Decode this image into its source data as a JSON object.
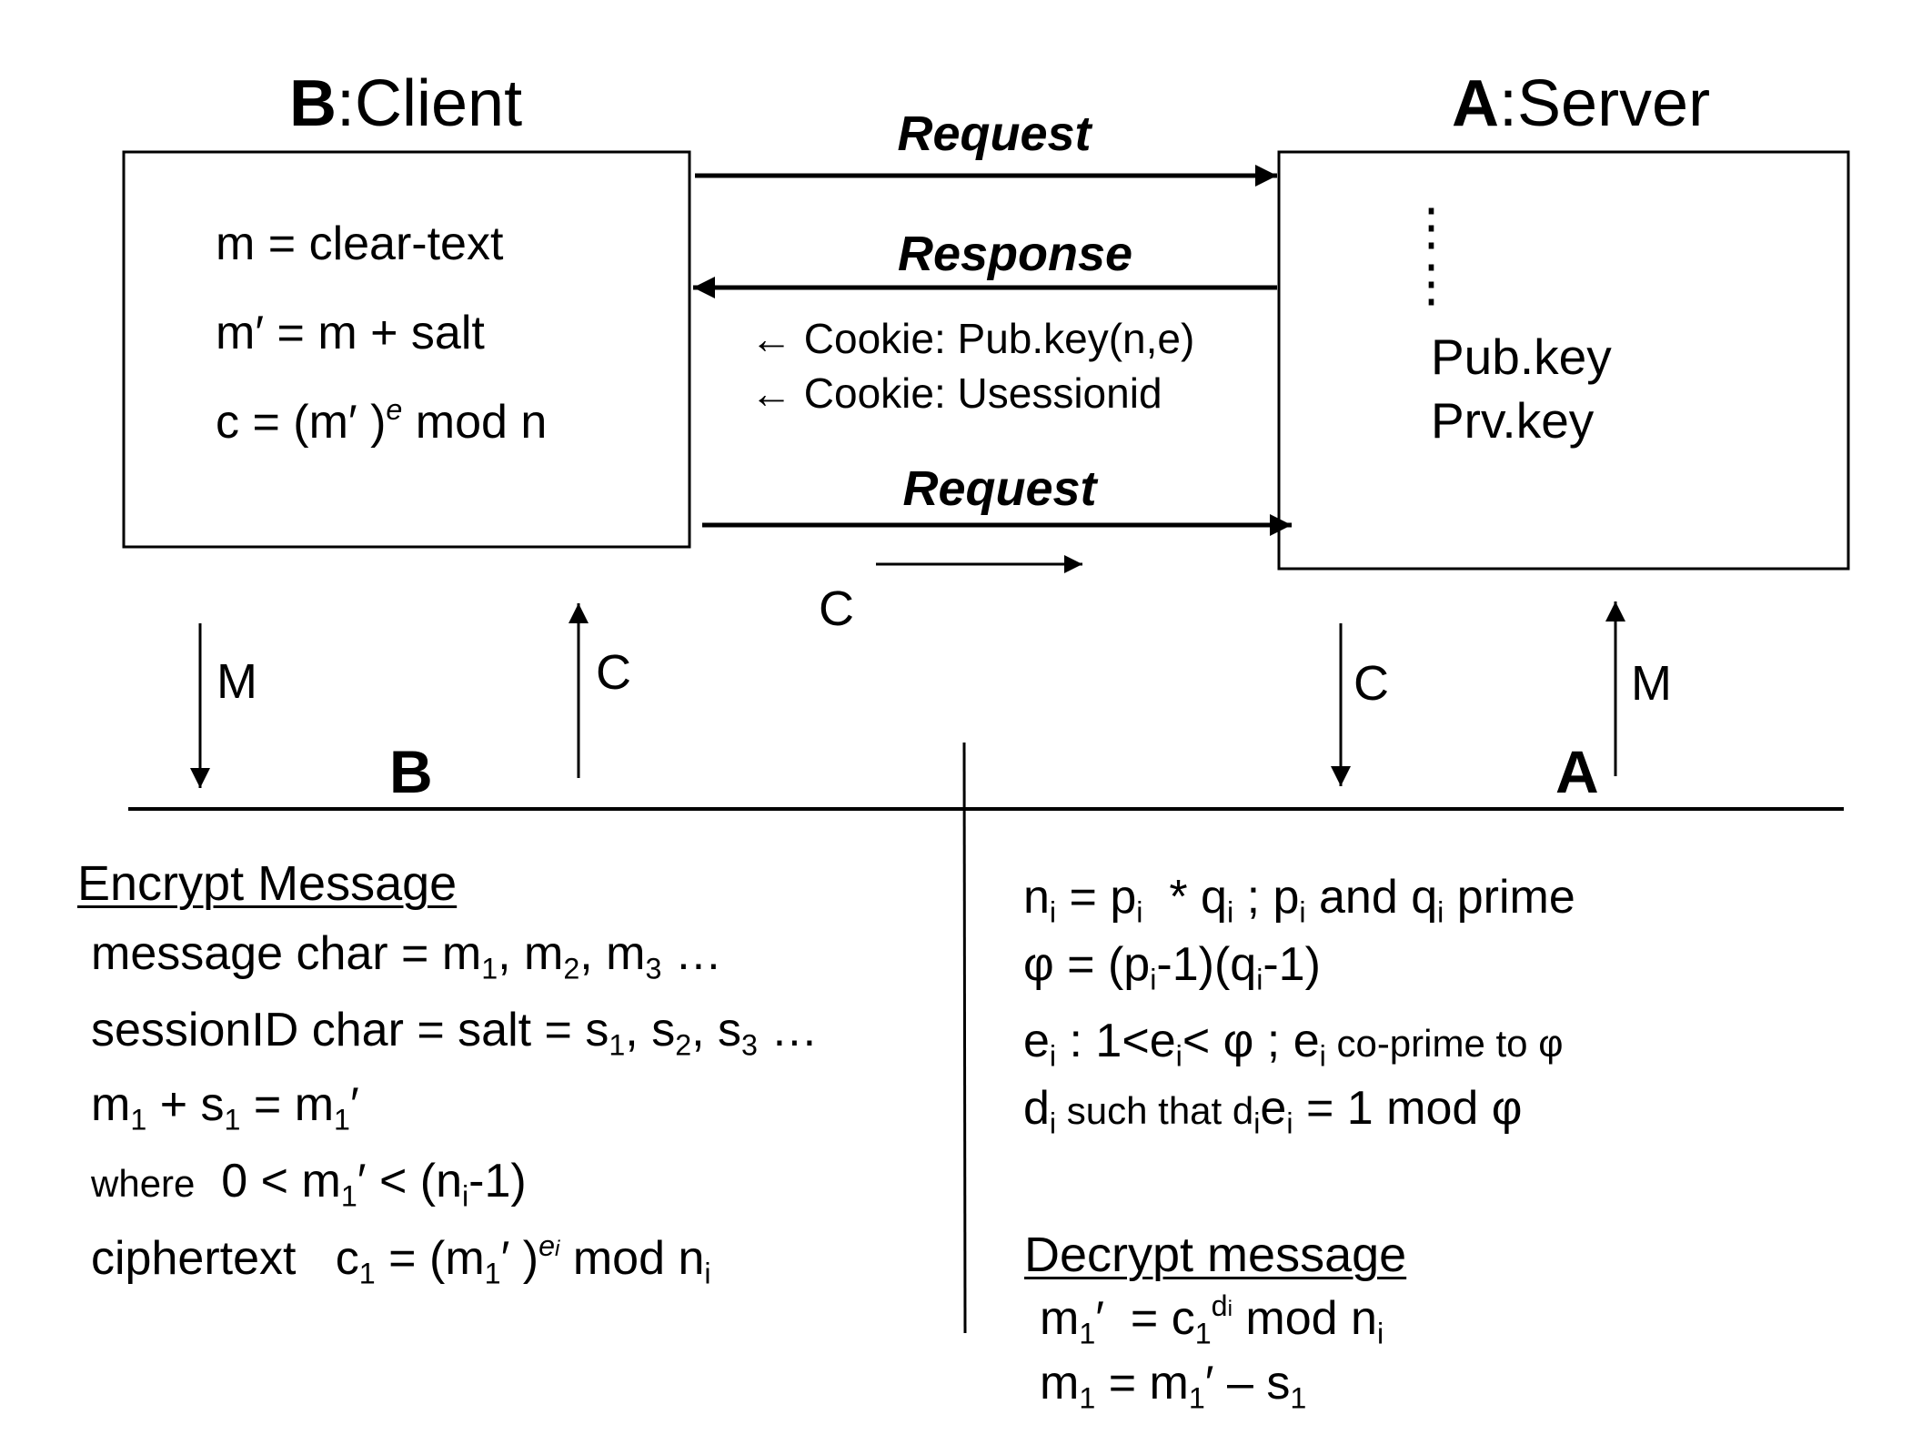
{
  "client": {
    "title_bold": "B",
    "title_rest": ":Client",
    "lines": [
      {
        "base": "m = clear-text"
      },
      {
        "base": "m′  = m + salt"
      },
      {
        "pre": "c = (m′ )",
        "sup": "e",
        "post": " mod n"
      }
    ]
  },
  "server": {
    "title_bold": "A",
    "title_rest": ":Server",
    "ellipsis": "⋮",
    "pub_key": "Pub.key",
    "prv_key": "Prv.key"
  },
  "messages": {
    "request1": "Request",
    "response": "Response",
    "cookie1": "← Cookie: Pub.key(n,e)",
    "cookie2": "← Cookie: Usessionid",
    "request2": "Request",
    "payload_label": "C"
  },
  "flows": {
    "client_down": "M",
    "client_up": "C",
    "server_down": "C",
    "server_up": "M"
  },
  "sides": {
    "left": "B",
    "right": "A"
  },
  "encrypt": {
    "heading": "Encrypt Message",
    "l1": {
      "a": "message char = m",
      "s1": "1",
      "b": ", m",
      "s2": "2",
      "c": ", m",
      "s3": "3",
      "d": " …"
    },
    "l2": {
      "a": "sessionID char = salt = s",
      "s1": "1",
      "b": ", s",
      "s2": "2",
      "c": ", s",
      "s3": "3",
      "d": " …"
    },
    "l3": {
      "a": "m",
      "s1": "1",
      "b": " + s",
      "s2": "1",
      "c": " = m",
      "s3": "1",
      "d": "′"
    },
    "l4": {
      "where": "where",
      "a": "  0 < m",
      "s1": "1",
      "b": "′ < (n",
      "s2": "i",
      "c": "-1)"
    },
    "l5": {
      "a": "ciphertext   c",
      "s1": "1",
      "b": " = (m",
      "s2": "1",
      "c": "′ )",
      "sup": "e",
      "supsub": "i",
      "d": " mod n",
      "s3": "i"
    }
  },
  "keygen": {
    "l1": {
      "a": "n",
      "s1": "i",
      "b": " = p",
      "s2": "i",
      "c": "  * q",
      "s3": "i",
      "d": " ; p",
      "s4": "i",
      "e": " and q",
      "s5": "i",
      "f": " prime"
    },
    "l2": {
      "a": "φ = (p",
      "s1": "i",
      "b": "-1)(q",
      "s2": "i",
      "c": "-1)"
    },
    "l3": {
      "a": "e",
      "s1": "i",
      "b": " : 1<e",
      "s2": "i",
      "c": "< φ ; e",
      "s3": "i",
      "d": " co-prime to φ"
    },
    "l4": {
      "a": "d",
      "s1": "i",
      "b": " such that d",
      "s2": "i",
      "c": "e",
      "s3": "i",
      "d": " = 1 mod φ"
    }
  },
  "decrypt": {
    "heading": "Decrypt message",
    "l1": {
      "a": "m",
      "s1": "1",
      "b": "′  = c",
      "s2": "1",
      "sup": "d",
      "supsub": "i",
      "c": " mod n",
      "s3": "i"
    },
    "l2": {
      "a": "m",
      "s1": "1",
      "b": " = m",
      "s2": "1",
      "c": "′ – s",
      "s3": "1"
    }
  }
}
